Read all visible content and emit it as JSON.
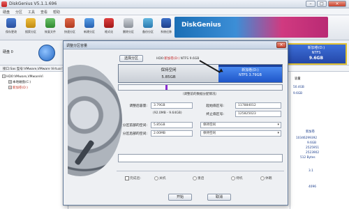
{
  "app": {
    "title": "DiskGenius V5.1.1.696"
  },
  "menu": [
    "硬盘",
    "分区",
    "工具",
    "查看",
    "帮助"
  ],
  "toolbar": {
    "buttons": [
      "保存更改",
      "搜索分区",
      "恢复文件",
      "快速分区",
      "新建分区",
      "格式化",
      "删除分区",
      "备份分区",
      "系统迁移"
    ],
    "banner_text": "DiskGenius"
  },
  "disk": {
    "label": "硬盘 0",
    "interface_line": "接口:Sas   型号:VMware,VMware Virtual S",
    "partition_box": {
      "name": "新加卷(D:)",
      "fs": "NTFS",
      "size": "9.6GB"
    }
  },
  "tree": {
    "root": "HD0:VMware,VMwareVi",
    "children": [
      "本地磁盘(C:)",
      "新加卷(D:)"
    ]
  },
  "right_column": {
    "header": "容量",
    "values": [
      "50.4GB",
      "9.6GB"
    ],
    "detail_title": "新加卷",
    "details": [
      "10346299392",
      "9.6GB",
      "2525951",
      "2523902",
      "512 Bytes",
      "3.1",
      "4096"
    ]
  },
  "dialog": {
    "title": "调整分区容量",
    "select_button": "选择分区",
    "top_info": {
      "prefix": "HD0:",
      "partition": "新加卷(D:)",
      "rest": " NTFS 9.6GB"
    },
    "bar": {
      "free_label": "保持空闲",
      "free_size": "5.85GB",
      "part_name": "新加卷(D:)",
      "part_detail": "NTFS 3.79GB",
      "free_fraction": 0.61
    },
    "slider_position": 0.29,
    "hint": "（调整前的数据分配情况）",
    "fields": {
      "after_size_label": "调整后容量:",
      "after_size": "3.79GB",
      "range": "(92.0MB - 9.64GB)",
      "start_sector_label": "起始扇区号:",
      "start_sector": "117884012",
      "end_sector_label": "终止扇区号:",
      "end_sector": "125825023",
      "front_space_label": "分区前部的空间:",
      "front_space": "5.85GB",
      "front_space_action": "保持空闲",
      "back_space_label": "分区后部的空间:",
      "back_space": "2.00MB",
      "back_space_action": "保持空闲"
    },
    "after_done_label": "完成后:",
    "options": [
      "关机",
      "重启",
      "待机",
      "休眠"
    ],
    "start_button": "开始",
    "cancel_button": "取消"
  }
}
